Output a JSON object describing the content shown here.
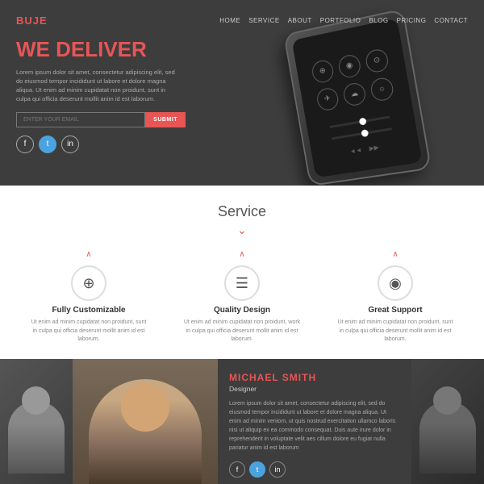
{
  "brand": {
    "logo": "BUJE"
  },
  "nav": {
    "links": [
      "HOME",
      "SERVICE",
      "ABOUT",
      "PORTFOLIO",
      "BLOG",
      "PRICING",
      "CONTACT"
    ]
  },
  "hero": {
    "title": "WE DELIVER",
    "description": "Lorem ipsum dolor sit amet, consectetur adipiscing elit, sed do eiusmod tempor incididunt ut labore et dolore magna aliqua. Ut enim ad minim cupidatat non proidunt, sunt in culpa qui officia deserunt mollit anim id est laborum.",
    "email_placeholder": "ENTER YOUR EMAIL",
    "submit_label": "SUBMIT",
    "social": [
      {
        "name": "facebook",
        "symbol": "f"
      },
      {
        "name": "twitter",
        "symbol": "t"
      },
      {
        "name": "linkedin",
        "symbol": "in"
      }
    ]
  },
  "service": {
    "title": "Service",
    "divider": "⌄",
    "items": [
      {
        "icon": "⊕",
        "name": "Fully Customizable",
        "desc": "Ut enim ad minim cupidatat non proidunt, sunt in culpa qui officia deserunt mollit anim id est laborum."
      },
      {
        "icon": "☰",
        "name": "Quality Design",
        "desc": "Ut enim ad minim cupidatat non proidunt, work in culpa qui officia deserunt mollit anim id est laborum."
      },
      {
        "icon": "◉",
        "name": "Great Support",
        "desc": "Ut enim ad minim cupidatat non proidunt, sunt in culpa qui officia deserunt mollit anim id est laborum."
      }
    ]
  },
  "testimonial": {
    "name": "MICHAEL SMITH",
    "role": "Designer",
    "description": "Lorem ipsum dolor sit amet, consectetur adipiscing elit, sed do eiusmod tempor incididunt ut labore et dolore magna aliqua. Ut enim ad minim veniom, ut quis nostrud exercitation ullamco laboris nisi ut aliquip ex ea commodo consequat. Duis aute irure dolor in reprehenderit in voluptate velit aes cillum dolore eu fugiat nulla pariatur anim id est laborum",
    "social": [
      {
        "name": "facebook",
        "symbol": "f"
      },
      {
        "name": "twitter",
        "symbol": "t"
      },
      {
        "name": "linkedin",
        "symbol": "in"
      }
    ]
  }
}
